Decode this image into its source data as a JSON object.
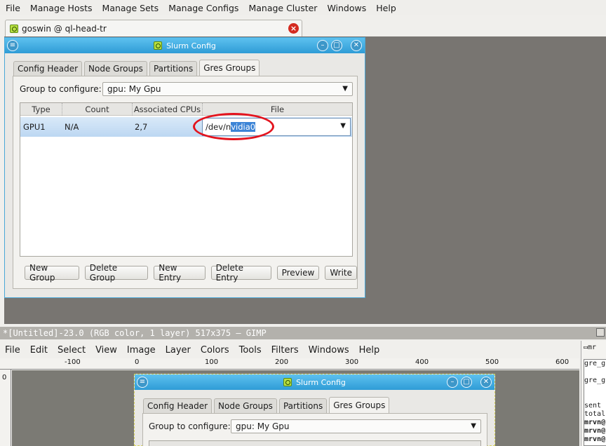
{
  "app_menu": [
    "File",
    "Manage Hosts",
    "Manage Sets",
    "Manage Configs",
    "Manage Cluster",
    "Windows",
    "Help"
  ],
  "main_tab": {
    "label": "goswin @ ql-head-tr"
  },
  "dialog": {
    "title": "Slurm Config",
    "tabs": [
      "Config Header",
      "Node Groups",
      "Partitions",
      "Gres Groups"
    ],
    "active_tab": "Gres Groups",
    "group_label": "Group to configure:",
    "group_value": "gpu: My Gpu",
    "columns": [
      "Type",
      "Count",
      "Associated CPUs",
      "File"
    ],
    "row": {
      "type": "GPU1",
      "count": "N/A",
      "cpus": "2,7",
      "file_prefix": "/dev/n",
      "file_selected": "vidia0"
    },
    "buttons": [
      "New Group",
      "Delete Group",
      "New Entry",
      "Delete Entry",
      "Preview",
      "Write"
    ]
  },
  "gimp": {
    "title": "*[Untitled]-23.0 (RGB color, 1 layer) 517x375 – GIMP",
    "menu": [
      "File",
      "Edit",
      "Select",
      "View",
      "Image",
      "Layer",
      "Colors",
      "Tools",
      "Filters",
      "Windows",
      "Help"
    ],
    "ruler_labels": [
      "-100",
      "0",
      "100",
      "200",
      "300",
      "400",
      "500",
      "600"
    ],
    "vruler_label": "0",
    "side_tab": "mr",
    "terminal_lines": [
      "gre_g",
      "",
      "gre_g",
      "",
      "",
      "sent",
      "total",
      "mrvn@",
      "mrvn@",
      "mrvn@"
    ]
  }
}
